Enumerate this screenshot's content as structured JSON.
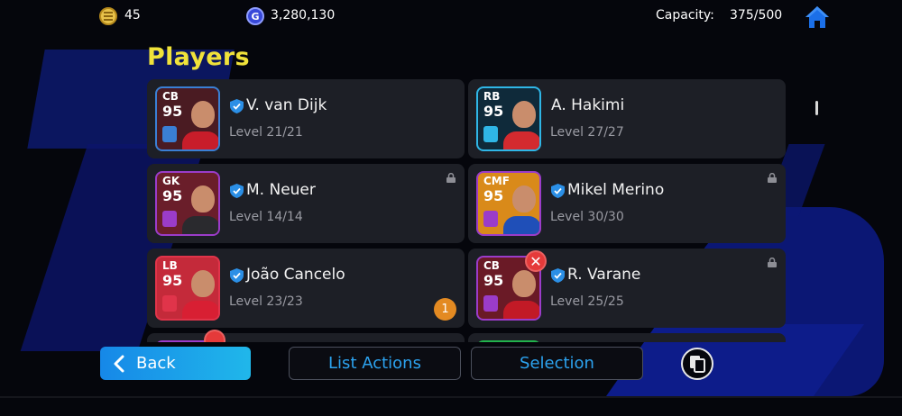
{
  "topbar": {
    "coins": "45",
    "gp": "3,280,130",
    "gp_glyph": "G",
    "capacity_label": "Capacity:",
    "capacity_value": "375/500"
  },
  "title": "Players",
  "players": [
    {
      "position": "CB",
      "rating": "95",
      "name": "V. van Dijk",
      "level": "Level 21/21",
      "card_color": "#3a7fd4",
      "shirt_color": "#c81d2a",
      "bg_color": "#4a1b22"
    },
    {
      "position": "RB",
      "rating": "95",
      "name": "A. Hakimi",
      "level": "Level 27/27",
      "card_color": "#2fb6e6",
      "shirt_color": "#d32a2f",
      "bg_color": "#0f2a3a"
    },
    {
      "position": "GK",
      "rating": "95",
      "name": "M. Neuer",
      "level": "Level 14/14",
      "card_color": "#9b3cc9",
      "shirt_color": "#2a2a2e",
      "bg_color": "#6a1e2a"
    },
    {
      "position": "CMF",
      "rating": "95",
      "name": "Mikel Merino",
      "level": "Level 30/30",
      "card_color": "#9b3cc9",
      "shirt_color": "#1f4fb8",
      "bg_color": "#d98a1a"
    },
    {
      "position": "LB",
      "rating": "95",
      "name": "João Cancelo",
      "level": "Level 23/23",
      "card_color": "#e0344a",
      "shirt_color": "#d81f33",
      "bg_color": "#c42a3a"
    },
    {
      "position": "CB",
      "rating": "95",
      "name": "R. Varane",
      "level": "Level 25/25",
      "card_color": "#9b3cc9",
      "shirt_color": "#c21a26",
      "bg_color": "#6a1a26"
    }
  ],
  "badge_count": "1",
  "remove_glyph": "✕",
  "buttons": {
    "back": "Back",
    "list_actions": "List Actions",
    "selection": "Selection"
  }
}
